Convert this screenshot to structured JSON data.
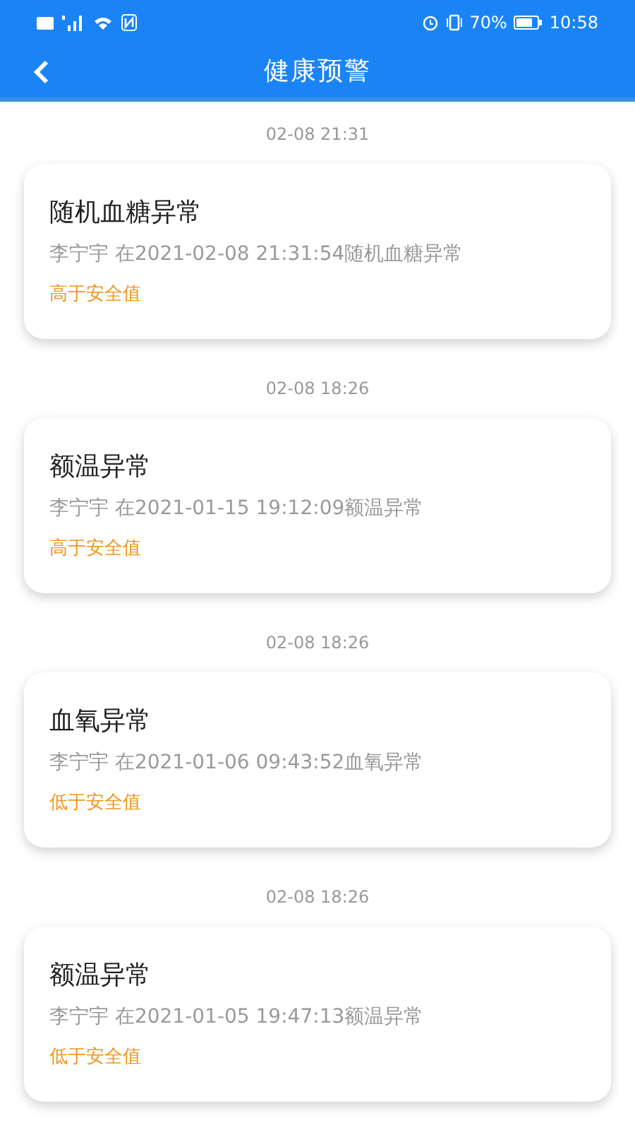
{
  "status_bar": {
    "battery": "70%",
    "time": "10:58"
  },
  "header": {
    "title": "健康预警"
  },
  "alerts": [
    {
      "timestamp": "02-08 21:31",
      "title": "随机血糖异常",
      "detail": "李宁宇 在2021-02-08 21:31:54随机血糖异常",
      "level_text": "高于安全值"
    },
    {
      "timestamp": "02-08 18:26",
      "title": "额温异常",
      "detail": "李宁宇 在2021-01-15 19:12:09额温异常",
      "level_text": "高于安全值"
    },
    {
      "timestamp": "02-08 18:26",
      "title": "血氧异常",
      "detail": "李宁宇 在2021-01-06 09:43:52血氧异常",
      "level_text": "低于安全值"
    },
    {
      "timestamp": "02-08 18:26",
      "title": "额温异常",
      "detail": "李宁宇 在2021-01-05 19:47:13额温异常",
      "level_text": "低于安全值"
    }
  ]
}
